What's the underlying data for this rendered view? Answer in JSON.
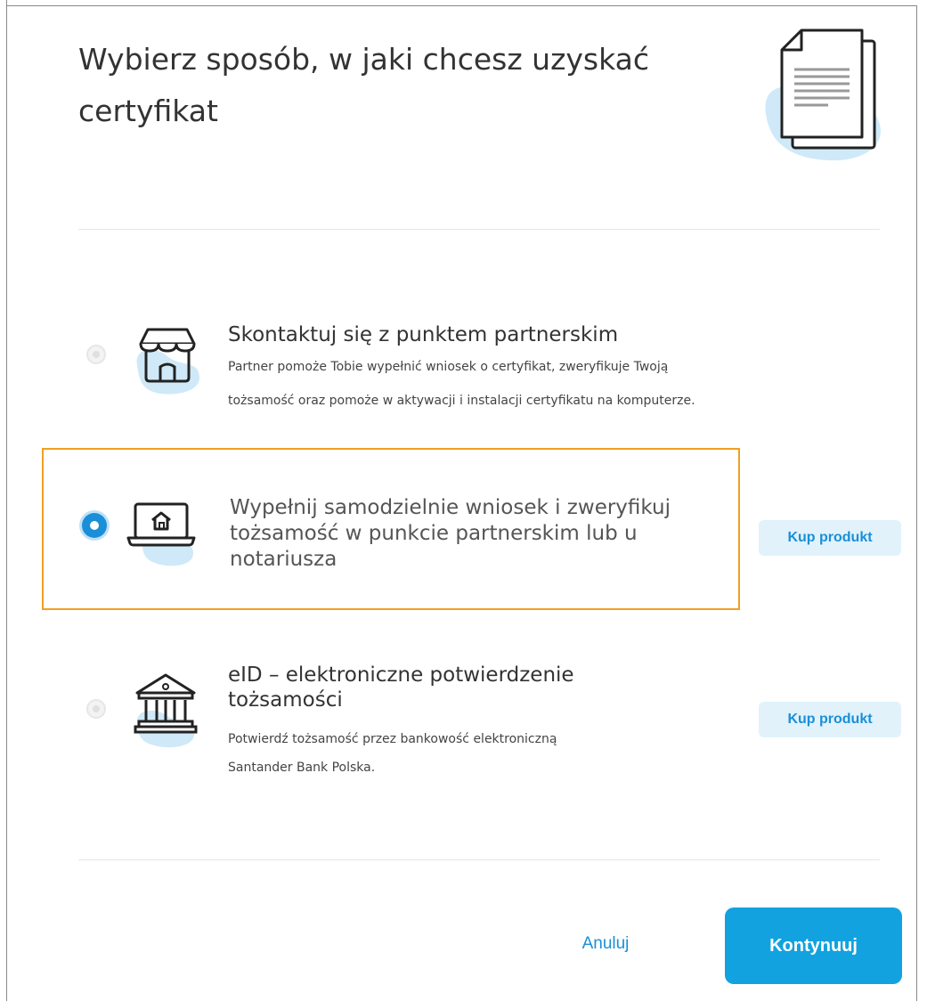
{
  "dialog": {
    "title": "Wybierz sposób, w jaki chcesz uzyskać certyfikat"
  },
  "options": [
    {
      "title": "Skontaktuj się z punktem partnerskim",
      "description_line1": "Partner pomoże Tobie wypełnić wniosek o certyfikat, zweryfikuje Twoją",
      "description_line2": "tożsamość oraz pomoże w aktywacji i instalacji certyfikatu na komputerze.",
      "icon": "store-icon",
      "state": "disabled"
    },
    {
      "title_line1": "Wypełnij samodzielnie wniosek i zweryfikuj",
      "title_line2": "tożsamość w punkcie partnerskim lub u",
      "title_line3": "notariusza",
      "icon": "laptop-home-icon",
      "state": "selected",
      "buy_label": "Kup produkt"
    },
    {
      "title_line1": "eID – elektroniczne potwierdzenie",
      "title_line2": "tożsamości",
      "description_line1": "Potwierdź tożsamość przez bankowość elektroniczną",
      "description_line2": "Santander Bank Polska.",
      "icon": "bank-icon",
      "state": "disabled",
      "buy_label": "Kup produkt"
    }
  ],
  "footer": {
    "cancel_label": "Anuluj",
    "continue_label": "Kontynuuj"
  },
  "colors": {
    "accent": "#12a2df",
    "selection_border": "#f0a020",
    "illustration_blob": "#cfe9f8"
  }
}
